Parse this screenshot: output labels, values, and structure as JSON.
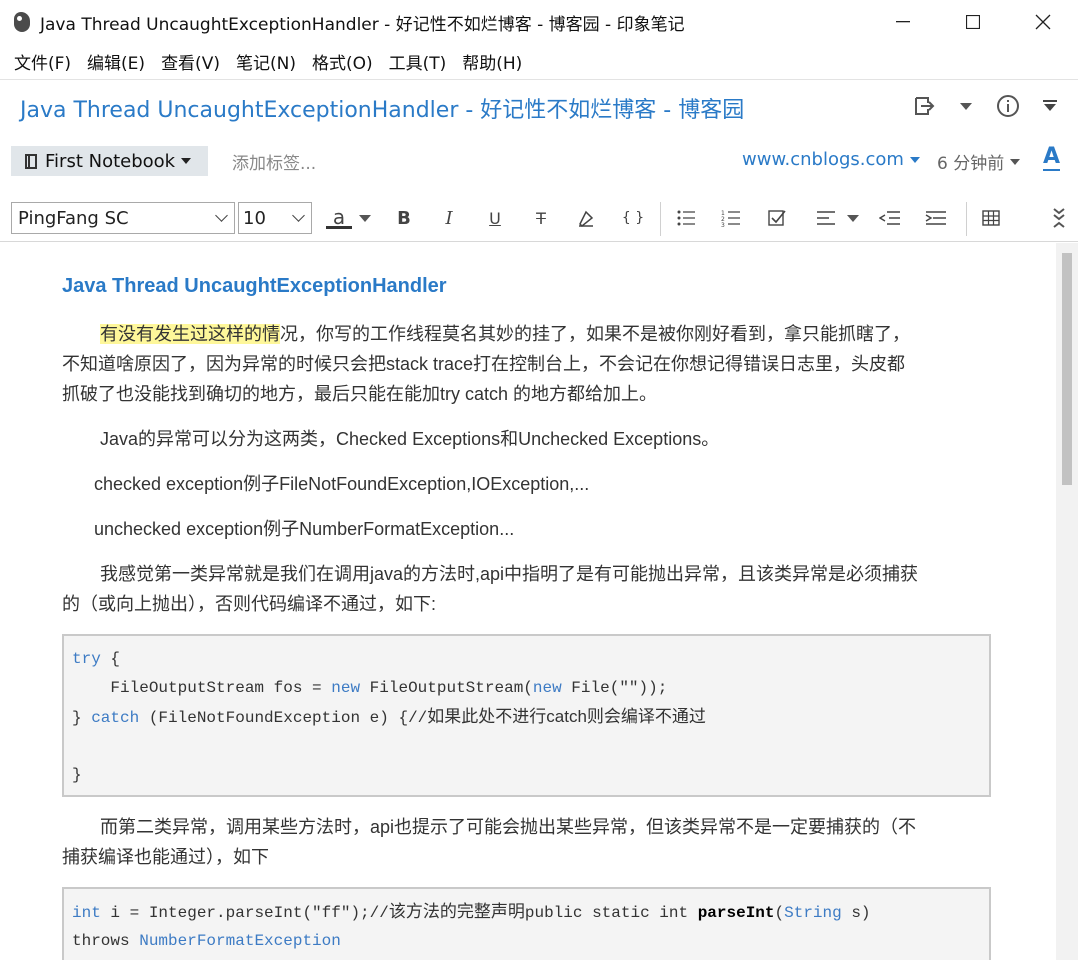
{
  "window": {
    "title": "Java Thread UncaughtExceptionHandler - 好记性不如烂博客 - 博客园 - 印象笔记",
    "minimize": "—",
    "maximize": "☐",
    "close": "✕"
  },
  "menu": [
    "文件(F)",
    "编辑(E)",
    "查看(V)",
    "笔记(N)",
    "格式(O)",
    "工具(T)",
    "帮助(H)"
  ],
  "note": {
    "title": "Java Thread UncaughtExceptionHandler - 好记性不如烂博客 - 博客园",
    "notebook": "First Notebook",
    "tag_placeholder": "添加标签...",
    "source": "www.cnblogs.com",
    "time": "6 分钟前",
    "font_btn": "A"
  },
  "toolbar": {
    "font": "PingFang SC",
    "size": "10",
    "text_color": "a",
    "bold": "B",
    "italic": "I",
    "underline": "U",
    "strike": "T",
    "code": "{ }"
  },
  "doc": {
    "heading": "Java Thread UncaughtExceptionHandler",
    "p1_hl": "有没有发生过这样的情",
    "p1_a": "况，你写的工作线程莫名其妙的挂了，如果不是被你刚好看到，拿只能抓瞎了，",
    "p1_b": "不知道啥原因了，因为异常的时候只会把stack trace打在控制台上，不会记在你想记得错误日志里，头皮都",
    "p1_c": "抓破了也没能找到确切的地方，最后只能在能加try catch 的地方都给加上。",
    "p2": "Java的异常可以分为这两类，Checked Exceptions和Unchecked Exceptions。",
    "p3": "checked exception例子FileNotFoundException,IOException,...",
    "p4": "unchecked exception例子NumberFormatException...",
    "p5_a": "我感觉第一类异常就是我们在调用java的方法时,api中指明了是有可能抛出异常，且该类异常是必须捕获",
    "p5_b": "的（或向上抛出），否则代码编译不通过，如下:",
    "code1": {
      "l1_kw": "try",
      "l1_rest": " {",
      "l2_a": "    FileOutputStream fos = ",
      "l2_kw1": "new",
      "l2_b": " FileOutputStream(",
      "l2_kw2": "new",
      "l2_c": " File(\"\"));",
      "l3_a": "} ",
      "l3_kw": "catch",
      "l3_b": " (FileNotFoundException e) {//",
      "l3_cm": "如果此处不进行catch则会编译不通过",
      "l5": "}"
    },
    "p6_a": "而第二类异常，调用某些方法时，api也提示了可能会抛出某些异常，但该类异常不是一定要捕获的（不",
    "p6_b": "捕获编译也能通过），如下",
    "code2": {
      "l1_kw": "int",
      "l1_a": " i = Integer.parseInt(\"ff\");//",
      "l1_cm": "该方法的完整声明",
      "l1_b": "public static int ",
      "l1_bold": "parseInt",
      "l1_c": "(",
      "l1_kw2": "String",
      "l1_d": " s)",
      "l2_a": "throws ",
      "l2_kw": "NumberFormatException"
    }
  }
}
